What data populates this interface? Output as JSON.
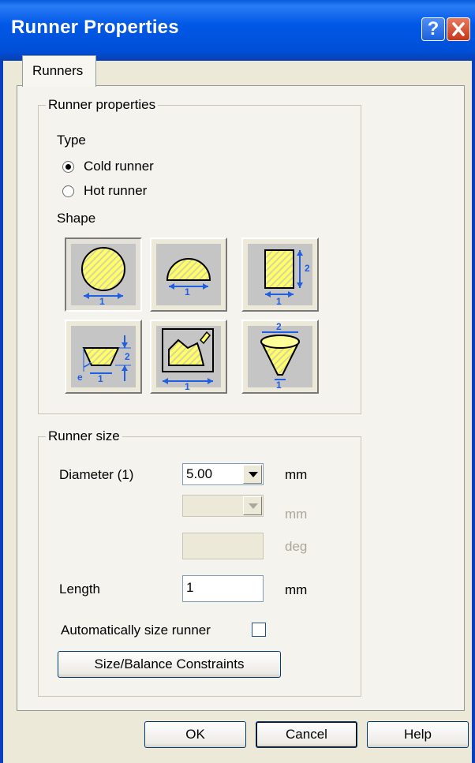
{
  "window": {
    "title": "Runner Properties",
    "help_icon": "question-mark-icon",
    "close_icon": "close-x-icon"
  },
  "tabs": [
    {
      "label": "Runners",
      "selected": true
    }
  ],
  "runner_properties": {
    "group_label": "Runner properties",
    "type_label": "Type",
    "type_options": [
      {
        "label": "Cold runner",
        "selected": true
      },
      {
        "label": "Hot runner",
        "selected": false
      }
    ],
    "shape_label": "Shape",
    "shape_icons": [
      "circular-shape-icon",
      "half-circular-shape-icon",
      "rectangular-shape-icon",
      "trapezoidal-shape-icon",
      "custom-shape-icon",
      "tapered-shape-icon"
    ],
    "shape_numbers": {
      "one": "1",
      "two": "2",
      "angle": "e"
    },
    "selected_shape": "circular-shape-icon"
  },
  "runner_size": {
    "group_label": "Runner size",
    "diameter_label": "Diameter (1)",
    "diameter_value": "5.00",
    "diameter_unit": "mm",
    "second_dim_value": "",
    "second_dim_unit": "mm",
    "angle_value": "",
    "angle_unit": "deg",
    "length_label": "Length",
    "length_value": "1",
    "length_unit": "mm",
    "auto_size_label": "Automatically size runner",
    "auto_size_checked": false,
    "constraints_button": "Size/Balance Constraints"
  },
  "buttons": {
    "ok": "OK",
    "cancel": "Cancel",
    "help": "Help"
  },
  "colors": {
    "titlebar": "#0058e6",
    "dialog_bg": "#ece9d8",
    "shape_fill": "#ffff66",
    "dimension_arrow": "#1f5fe0"
  }
}
